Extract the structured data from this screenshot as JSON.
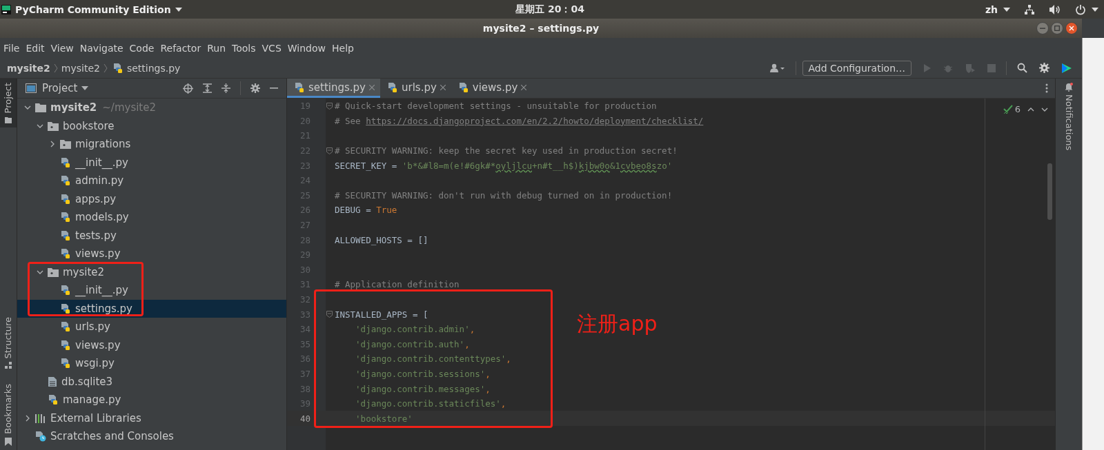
{
  "top_bar": {
    "app_menu": "PyCharm Community Edition",
    "clock": "星期五 20：04",
    "input_method": "zh"
  },
  "window": {
    "title": "mysite2 – settings.py"
  },
  "menu": [
    "File",
    "Edit",
    "View",
    "Navigate",
    "Code",
    "Refactor",
    "Run",
    "Tools",
    "VCS",
    "Window",
    "Help"
  ],
  "breadcrumbs": [
    {
      "label": "mysite2",
      "kind": "project"
    },
    {
      "label": "mysite2",
      "kind": "folder"
    },
    {
      "label": "settings.py",
      "kind": "py"
    }
  ],
  "run_config": {
    "label": "Add Configuration…"
  },
  "left_strip": [
    {
      "label": "Project",
      "selected": true,
      "kind": "project"
    },
    {
      "label": "Structure",
      "selected": false,
      "kind": "structure"
    },
    {
      "label": "Bookmarks",
      "selected": false,
      "kind": "bookmarks"
    }
  ],
  "right_strip": [
    {
      "label": "Notifications",
      "kind": "notifications"
    }
  ],
  "project_panel": {
    "title": "Project",
    "tree": [
      {
        "label": "mysite2",
        "hint": "~/mysite2",
        "kind": "project",
        "expanded": true,
        "selected": false,
        "children": [
          {
            "label": "bookstore",
            "kind": "package",
            "expanded": true,
            "selected": false,
            "children": [
              {
                "label": "migrations",
                "kind": "package",
                "expanded": false,
                "selected": false
              },
              {
                "label": "__init__.py",
                "kind": "py",
                "selected": false
              },
              {
                "label": "admin.py",
                "kind": "py",
                "selected": false
              },
              {
                "label": "apps.py",
                "kind": "py",
                "selected": false
              },
              {
                "label": "models.py",
                "kind": "py",
                "selected": false
              },
              {
                "label": "tests.py",
                "kind": "py",
                "selected": false
              },
              {
                "label": "views.py",
                "kind": "py",
                "selected": false
              }
            ]
          },
          {
            "label": "mysite2",
            "kind": "package",
            "expanded": true,
            "selected": false,
            "children": [
              {
                "label": "__init__.py",
                "kind": "py",
                "selected": false
              },
              {
                "label": "settings.py",
                "kind": "py",
                "selected": true
              },
              {
                "label": "urls.py",
                "kind": "py",
                "selected": false
              },
              {
                "label": "views.py",
                "kind": "py",
                "selected": false
              },
              {
                "label": "wsgi.py",
                "kind": "py",
                "selected": false
              }
            ]
          },
          {
            "label": "db.sqlite3",
            "kind": "file",
            "selected": false
          },
          {
            "label": "manage.py",
            "kind": "py",
            "selected": false
          }
        ]
      },
      {
        "label": "External Libraries",
        "kind": "libraries",
        "expanded": false,
        "selected": false
      },
      {
        "label": "Scratches and Consoles",
        "kind": "scratches",
        "selected": false
      }
    ]
  },
  "editor": {
    "tabs": [
      {
        "label": "settings.py",
        "selected": true
      },
      {
        "label": "urls.py",
        "selected": false
      },
      {
        "label": "views.py",
        "selected": false
      }
    ],
    "inspections": {
      "count": "6"
    },
    "lines": [
      {
        "number": "19",
        "fold": true,
        "current": false,
        "tokens": [
          {
            "kind": "comment",
            "text": "# Quick-start development settings - unsuitable for production"
          }
        ]
      },
      {
        "number": "20",
        "fold": false,
        "current": false,
        "tokens": [
          {
            "kind": "comment",
            "text": "# See "
          },
          {
            "kind": "link",
            "text": "https://docs.djangoproject.com/en/2.2/howto/deployment/checklist/"
          }
        ]
      },
      {
        "number": "21",
        "fold": false,
        "current": false
      },
      {
        "number": "22",
        "fold": true,
        "current": false,
        "tokens": [
          {
            "kind": "comment",
            "text": "# SECURITY WARNING: keep the secret key used in production secret!"
          }
        ]
      },
      {
        "number": "23",
        "fold": false,
        "current": false,
        "tokens": [
          {
            "kind": "text",
            "text": "SECRET_KEY = "
          },
          {
            "kind": "str",
            "text": "'b*&#l8=m(e!#6gk#*"
          },
          {
            "kind": "typo",
            "text": "oyljlcu"
          },
          {
            "kind": "str",
            "text": "+n#t__h$)"
          },
          {
            "kind": "typo",
            "text": "kjbw0o"
          },
          {
            "kind": "str",
            "text": "&1"
          },
          {
            "kind": "typo",
            "text": "cvbeo8s"
          },
          {
            "kind": "str",
            "text": "zo'"
          }
        ]
      },
      {
        "number": "24",
        "fold": false,
        "current": false
      },
      {
        "number": "25",
        "fold": false,
        "current": false,
        "tokens": [
          {
            "kind": "comment",
            "text": "# SECURITY WARNING: don't run with debug turned on in production!"
          }
        ]
      },
      {
        "number": "26",
        "fold": false,
        "current": false,
        "tokens": [
          {
            "kind": "text",
            "text": "DEBUG = "
          },
          {
            "kind": "kw",
            "text": "True"
          }
        ]
      },
      {
        "number": "27",
        "fold": false,
        "current": false
      },
      {
        "number": "28",
        "fold": false,
        "current": false,
        "tokens": [
          {
            "kind": "text",
            "text": "ALLOWED_HOSTS = []"
          }
        ]
      },
      {
        "number": "29",
        "fold": false,
        "current": false
      },
      {
        "number": "30",
        "fold": false,
        "current": false
      },
      {
        "number": "31",
        "fold": false,
        "current": false,
        "tokens": [
          {
            "kind": "comment",
            "text": "# Application definition"
          }
        ]
      },
      {
        "number": "32",
        "fold": false,
        "current": false
      },
      {
        "number": "33",
        "fold": true,
        "current": false,
        "tokens": [
          {
            "kind": "text",
            "text": "INSTALLED_APPS = ["
          }
        ]
      },
      {
        "number": "34",
        "fold": false,
        "current": false,
        "indent": true,
        "tokens": [
          {
            "kind": "str",
            "text": "'django.contrib.admin'"
          },
          {
            "kind": "punct",
            "text": ","
          }
        ]
      },
      {
        "number": "35",
        "fold": false,
        "current": false,
        "indent": true,
        "tokens": [
          {
            "kind": "str",
            "text": "'django.contrib.auth'"
          },
          {
            "kind": "punct",
            "text": ","
          }
        ]
      },
      {
        "number": "36",
        "fold": false,
        "current": false,
        "indent": true,
        "tokens": [
          {
            "kind": "str",
            "text": "'django.contrib.contenttypes'"
          },
          {
            "kind": "punct",
            "text": ","
          }
        ]
      },
      {
        "number": "37",
        "fold": false,
        "current": false,
        "indent": true,
        "tokens": [
          {
            "kind": "str",
            "text": "'django.contrib.sessions'"
          },
          {
            "kind": "punct",
            "text": ","
          }
        ]
      },
      {
        "number": "38",
        "fold": false,
        "current": false,
        "indent": true,
        "tokens": [
          {
            "kind": "str",
            "text": "'django.contrib.messages'"
          },
          {
            "kind": "punct",
            "text": ","
          }
        ]
      },
      {
        "number": "39",
        "fold": false,
        "current": false,
        "indent": true,
        "tokens": [
          {
            "kind": "str",
            "text": "'django.contrib.staticfiles'"
          },
          {
            "kind": "punct",
            "text": ","
          }
        ]
      },
      {
        "number": "40",
        "fold": false,
        "current": true,
        "indent": true,
        "tokens": [
          {
            "kind": "str",
            "text": "'bookstore'"
          }
        ]
      }
    ]
  },
  "annotations": [
    {
      "kind": "note",
      "text": "注册app"
    },
    {
      "kind": "tree_box"
    },
    {
      "kind": "code_box"
    }
  ]
}
